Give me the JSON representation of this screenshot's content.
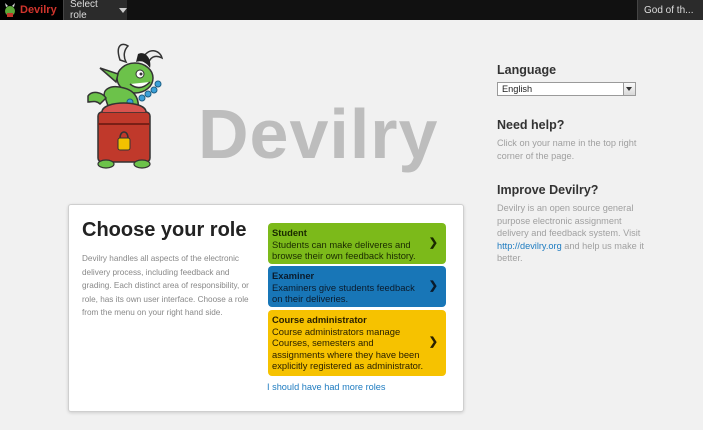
{
  "topbar": {
    "brand": "Devilry",
    "role_select": "Select role",
    "user_menu": "God of th..."
  },
  "hero": {
    "title": "Devilry"
  },
  "choose_role": {
    "title": "Choose your role",
    "description": "Devilry handles all aspects of the electronic delivery process, including feedback and grading. Each distinct area of responsibility, or role, has its own user interface. Choose a role from the menu on your right hand side.",
    "roles": [
      {
        "name": "Student",
        "text": "Students can make deliveres and browse their own feedback history.",
        "color": "#7cba1a"
      },
      {
        "name": "Examiner",
        "text": "Examiners give students feedback on their deliveries.",
        "color": "#1876b7"
      },
      {
        "name": "Course administrator",
        "text": "Course administrators manage Courses, semesters and assignments where they have been explicitly registered as administrator.",
        "color": "#f6c200"
      }
    ],
    "more_roles_link": "I should have had more roles"
  },
  "sidebar": {
    "language": {
      "title": "Language",
      "selected": "English"
    },
    "help": {
      "title": "Need help?",
      "text": "Click on your name in the top right corner of the page."
    },
    "improve": {
      "title": "Improve Devilry?",
      "text_before": "Devilry is an open source general purpose electronic assignment delivery and feedback system. Visit",
      "link": "http://devilry.org",
      "text_after": "and help us make it better."
    }
  },
  "icons": {
    "brand_icon": "devil-icon",
    "role_caret": "chevron-down-icon",
    "role_arrow": "chevron-right-icon",
    "language_dropdown": "chevron-down-icon"
  }
}
